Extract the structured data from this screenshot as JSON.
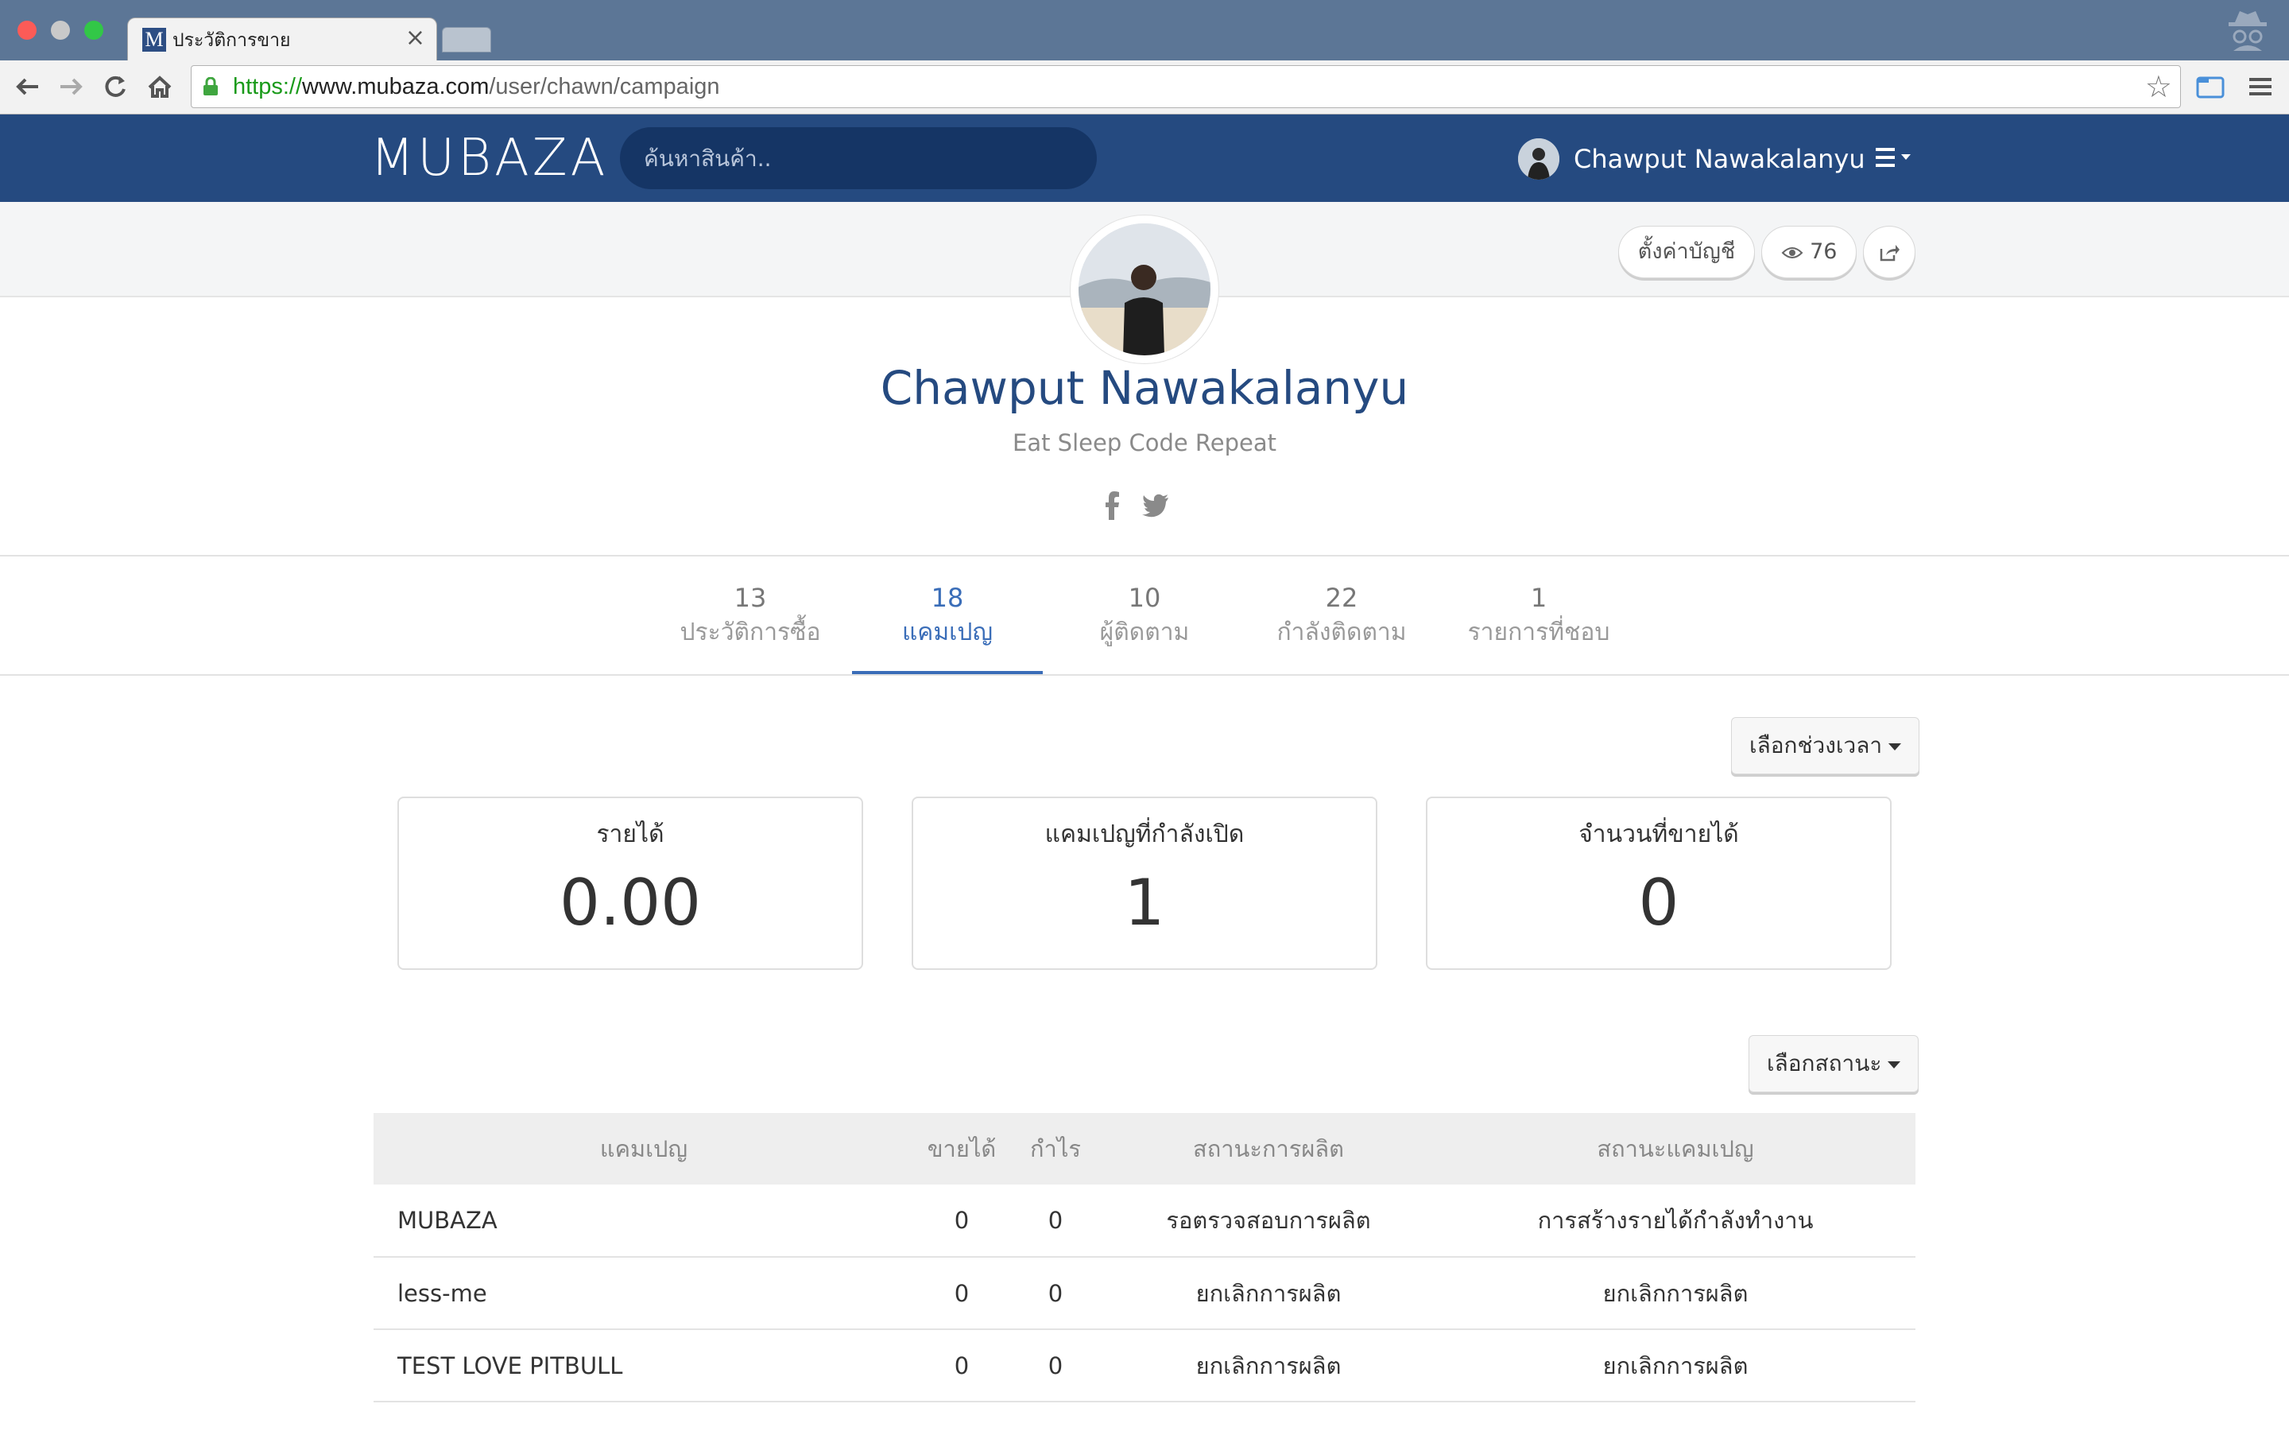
{
  "browser": {
    "tab_title": "ประวัติการขาย",
    "tab_favicon_letter": "M",
    "url_scheme": "https://",
    "url_host": "www.mubaza.com",
    "url_path": "/user/chawn/campaign"
  },
  "header": {
    "logo": "MUBAZA",
    "search_placeholder": "ค้นหาสินค้า..",
    "user_name": "Chawput Nawakalanyu"
  },
  "profile": {
    "settings_label": "ตั้งค่าบัญชี",
    "view_count": "76",
    "name": "Chawput Nawakalanyu",
    "bio": "Eat Sleep Code Repeat"
  },
  "stat_tabs": [
    {
      "count": "13",
      "label": "ประวัติการซื้อ"
    },
    {
      "count": "18",
      "label": "แคมเปญ"
    },
    {
      "count": "10",
      "label": "ผู้ติดตาม"
    },
    {
      "count": "22",
      "label": "กำลังติดตาม"
    },
    {
      "count": "1",
      "label": "รายการที่ชอบ"
    }
  ],
  "dashboard": {
    "period_dropdown": "เลือกช่วงเวลา",
    "status_dropdown": "เลือกสถานะ",
    "cards": [
      {
        "title": "รายได้",
        "value": "0.00"
      },
      {
        "title": "แคมเปญที่กำลังเปิด",
        "value": "1"
      },
      {
        "title": "จำนวนที่ขายได้",
        "value": "0"
      }
    ]
  },
  "table": {
    "headers": [
      "แคมเปญ",
      "ขายได้",
      "กำไร",
      "สถานะการผลิต",
      "สถานะแคมเปญ"
    ],
    "rows": [
      {
        "name": "MUBAZA",
        "sold": "0",
        "profit": "0",
        "production_status": "รอตรวจสอบการผลิต",
        "campaign_status": "การสร้างรายได้กำลังทำงาน"
      },
      {
        "name": "less-me",
        "sold": "0",
        "profit": "0",
        "production_status": "ยกเลิกการผลิต",
        "campaign_status": "ยกเลิกการผลิต"
      },
      {
        "name": "TEST LOVE PITBULL",
        "sold": "0",
        "profit": "0",
        "production_status": "ยกเลิกการผลิต",
        "campaign_status": "ยกเลิกการผลิต"
      }
    ]
  },
  "colors": {
    "header_bg": "#254a80",
    "accent": "#3a6db8",
    "name_color": "#254a80"
  }
}
